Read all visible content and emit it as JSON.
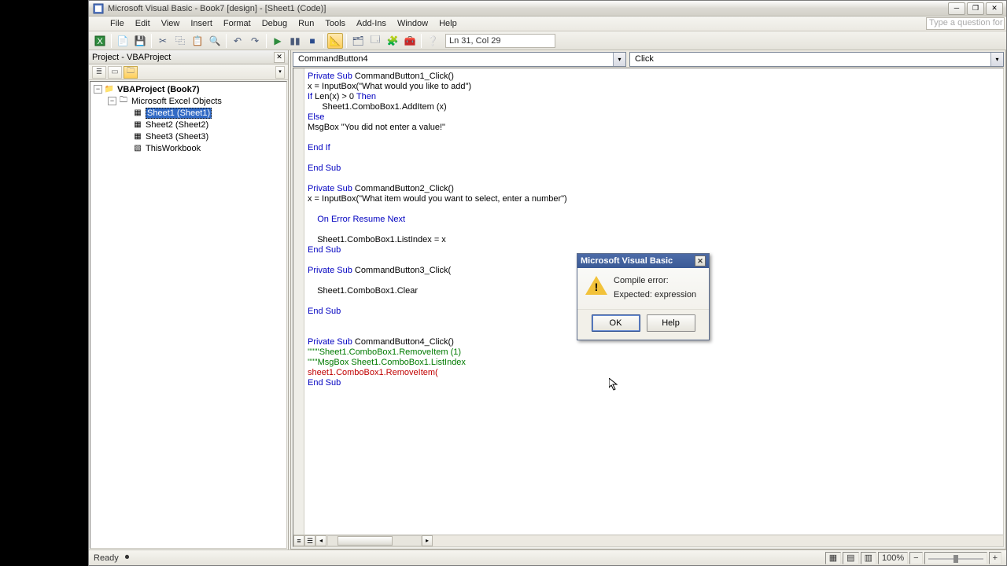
{
  "window": {
    "title": "Microsoft Visual Basic - Book7 [design] - [Sheet1 (Code)]"
  },
  "menu": {
    "file": "File",
    "edit": "Edit",
    "view": "View",
    "insert": "Insert",
    "format": "Format",
    "debug": "Debug",
    "run": "Run",
    "tools": "Tools",
    "addins": "Add-Ins",
    "window": "Window",
    "help": "Help",
    "question_placeholder": "Type a question for help"
  },
  "toolbar": {
    "position": "Ln 31, Col 29"
  },
  "project_panel": {
    "title": "Project - VBAProject",
    "root": "VBAProject (Book7)",
    "folder": "Microsoft Excel Objects",
    "sheet1": "Sheet1 (Sheet1)",
    "sheet2": "Sheet2 (Sheet2)",
    "sheet3": "Sheet3 (Sheet3)",
    "thiswb": "ThisWorkbook"
  },
  "code_dropdowns": {
    "object": "CommandButton4",
    "proc": "Click"
  },
  "code": {
    "l01a": "Private Sub",
    "l01b": " CommandButton1_Click()",
    "l02": "x = InputBox(\"What would you like to add\")",
    "l03a": "If",
    "l03b": " Len(x) > 0 ",
    "l03c": "Then",
    "l04": "      Sheet1.ComboBox1.AddItem (x)",
    "l05": "Else",
    "l06": "MsgBox \"You did not enter a value!\"",
    "l07": "",
    "l08": "End If",
    "l09": "",
    "l10": "End Sub",
    "l11": "",
    "l12a": "Private Sub",
    "l12b": " CommandButton2_Click()",
    "l13": "x = InputBox(\"What item would you want to select, enter a number\")",
    "l14": "",
    "l15a": "    On Error Resume Next",
    "l16": "",
    "l17": "    Sheet1.ComboBox1.ListIndex = x",
    "l18": "End Sub",
    "l19": "",
    "l20a": "Private Sub",
    "l20b": " CommandButton3_Click(",
    "l21": "",
    "l22": "    Sheet1.ComboBox1.Clear",
    "l23": "",
    "l24": "End Sub",
    "l25": "",
    "l26": "",
    "l27a": "Private Sub",
    "l27b": " CommandButton4_Click()",
    "l28": "'''''''Sheet1.ComboBox1.RemoveItem (1)",
    "l29": "''''''MsgBox Sheet1.ComboBox1.ListIndex",
    "l30": "sheet1.ComboBox1.RemoveItem(",
    "l31": "End Sub"
  },
  "dialog": {
    "title": "Microsoft Visual Basic",
    "line1": "Compile error:",
    "line2": "Expected: expression",
    "ok": "OK",
    "help": "Help"
  },
  "status": {
    "ready": "Ready",
    "zoom": "100%"
  }
}
